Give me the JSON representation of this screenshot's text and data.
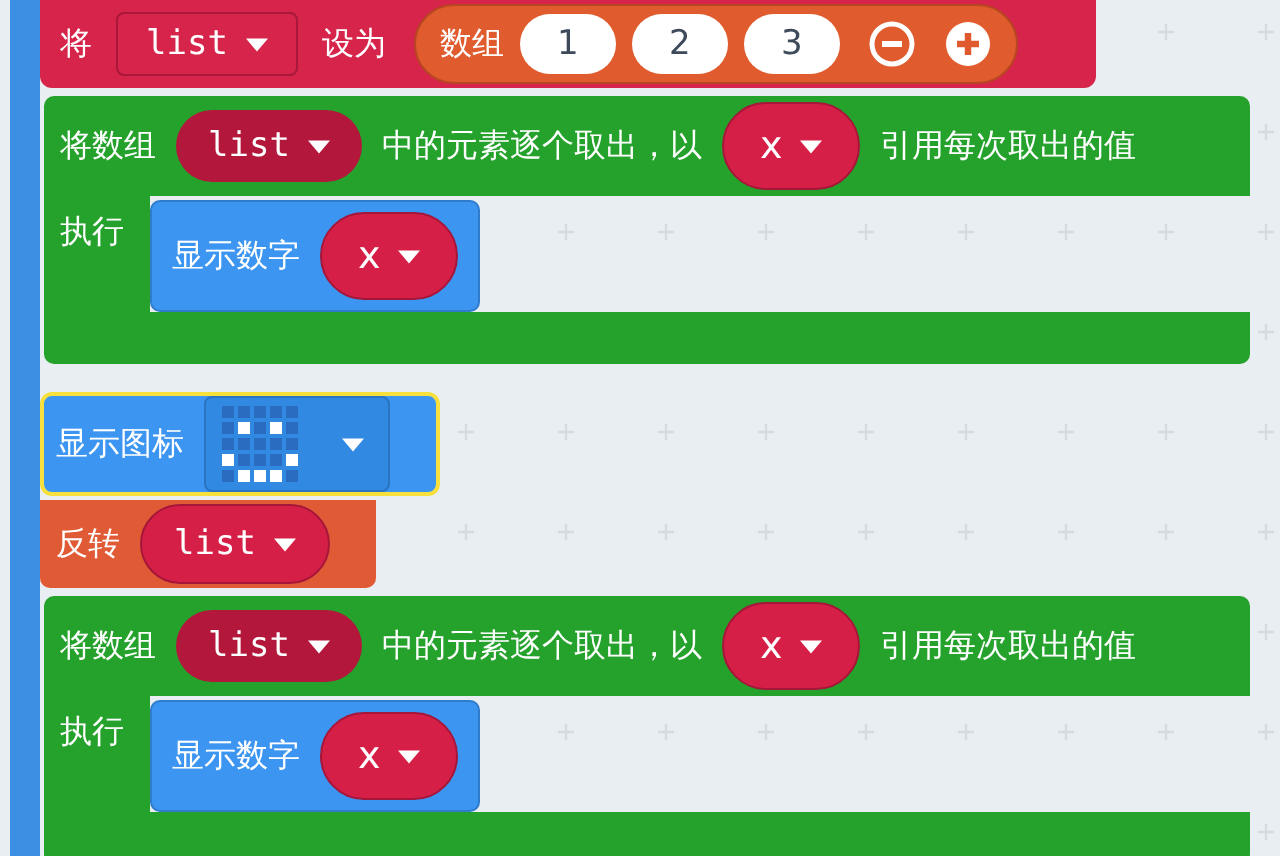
{
  "workspace": {
    "blocks": [
      {
        "kind": "set",
        "selected": false,
        "label": "将",
        "variable": "list",
        "verb": "设为",
        "array": {
          "label": "数组",
          "items": [
            "1",
            "2",
            "3"
          ]
        }
      },
      {
        "kind": "foreach",
        "selected": false,
        "prefix": "将数组",
        "list": "list",
        "middle": "中的元素逐个取出，以",
        "var": "x",
        "suffix": "引用每次取出的值",
        "do": "执行",
        "body": {
          "label": "显示数字",
          "value": "x"
        }
      },
      {
        "kind": "icon",
        "selected": true,
        "label": "显示图标",
        "leds": [
          [
            false,
            false,
            false,
            false,
            false
          ],
          [
            false,
            true,
            false,
            true,
            false
          ],
          [
            false,
            false,
            false,
            false,
            false
          ],
          [
            true,
            false,
            false,
            false,
            true
          ],
          [
            false,
            true,
            true,
            true,
            false
          ]
        ]
      },
      {
        "kind": "reverse",
        "selected": false,
        "label": "反转",
        "list": "list"
      },
      {
        "kind": "foreach",
        "selected": false,
        "prefix": "将数组",
        "list": "list",
        "middle": "中的元素逐个取出，以",
        "var": "x",
        "suffix": "引用每次取出的值",
        "do": "执行",
        "body": {
          "label": "显示数字",
          "value": "x"
        }
      }
    ]
  }
}
